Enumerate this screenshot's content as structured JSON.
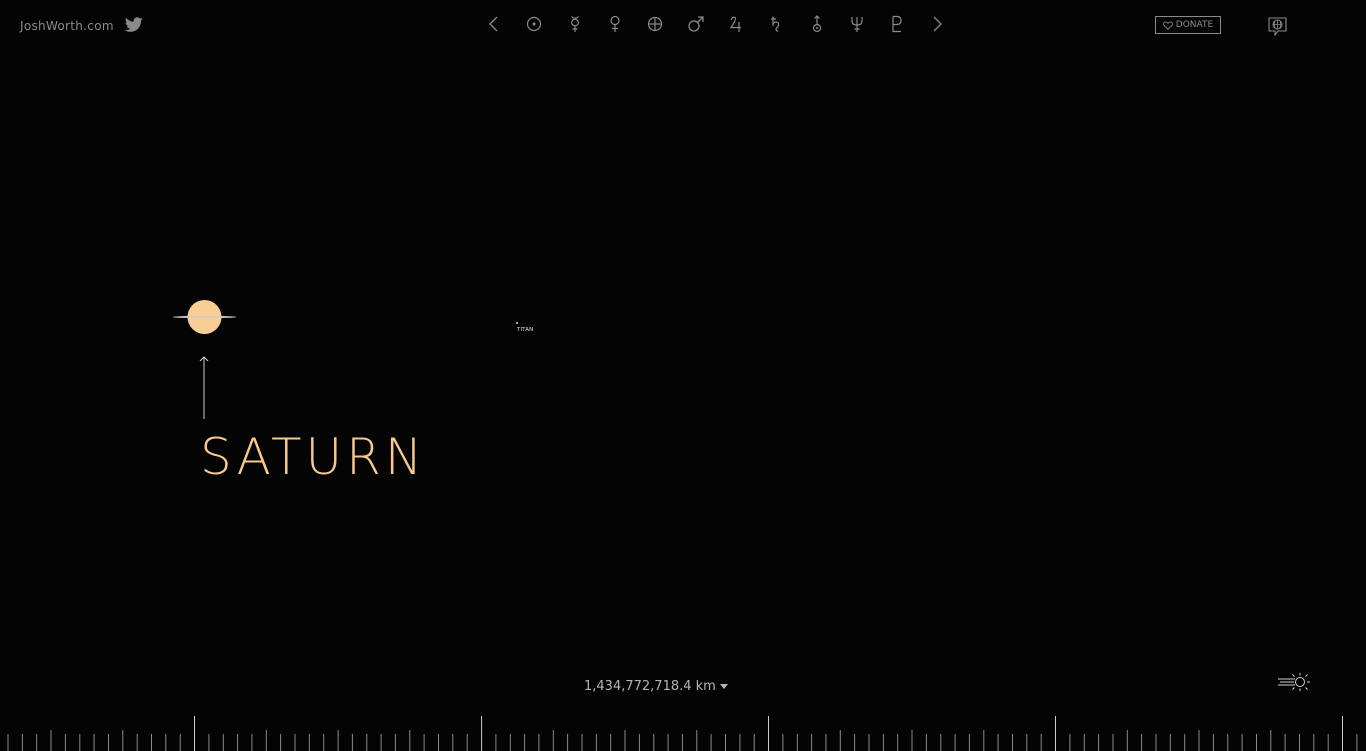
{
  "header": {
    "site_link": "JoshWorth.com",
    "twitter_icon": "twitter-bird-icon",
    "donate_label": "DONATE",
    "donate_icon": "heart-outline-icon",
    "language_icon": "globe-speech-icon"
  },
  "nav": {
    "items": [
      {
        "name": "prev",
        "icon": "chevron-left-icon"
      },
      {
        "name": "sun",
        "icon": "sun-symbol-icon"
      },
      {
        "name": "mercury",
        "icon": "mercury-symbol-icon"
      },
      {
        "name": "venus",
        "icon": "venus-symbol-icon"
      },
      {
        "name": "earth",
        "icon": "earth-symbol-icon"
      },
      {
        "name": "mars",
        "icon": "mars-symbol-icon"
      },
      {
        "name": "jupiter",
        "icon": "jupiter-symbol-icon"
      },
      {
        "name": "saturn",
        "icon": "saturn-symbol-icon"
      },
      {
        "name": "uranus",
        "icon": "uranus-symbol-icon"
      },
      {
        "name": "neptune",
        "icon": "neptune-symbol-icon"
      },
      {
        "name": "pluto",
        "icon": "pluto-symbol-icon"
      },
      {
        "name": "next",
        "icon": "chevron-right-icon"
      }
    ]
  },
  "main": {
    "planet_name": "SATURN",
    "moon_label": "TITAN",
    "planet_color": "#f9ce95"
  },
  "footer": {
    "distance": "1,434,772,718.4 km",
    "unit_dropdown_icon": "caret-down-icon",
    "lightspeed_icon": "lightspeed-sun-icon"
  },
  "colors": {
    "background": "#040404",
    "accent": "#f7c98a",
    "muted": "#8a8a8a"
  }
}
